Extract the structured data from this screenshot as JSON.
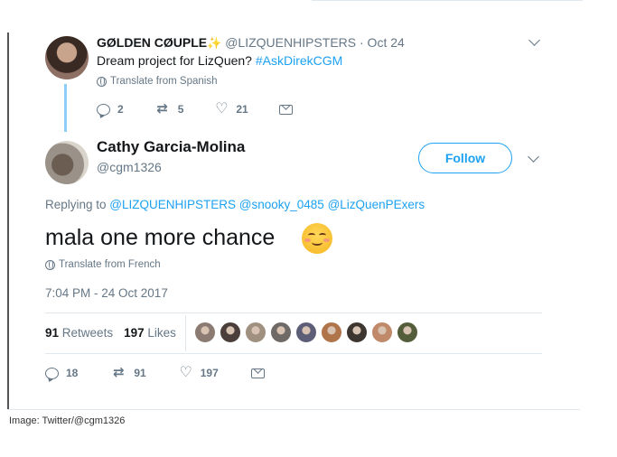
{
  "tweet1": {
    "name": "GØLDEN CØUPLE",
    "sparkle": "✨",
    "handle": "@LIZQUENHIPSTERS",
    "date": "· Oct 24",
    "text": "Dream project for LizQuen? ",
    "hashtag": "#AskDirekCGM",
    "translate": "Translate from Spanish",
    "replies": "2",
    "retweets": "5",
    "likes": "21"
  },
  "tweet2": {
    "name": "Cathy Garcia-Molina",
    "handle": "@cgm1326",
    "follow_label": "Follow",
    "replying_prefix": "Replying to ",
    "mentions": [
      "@LIZQUENHIPSTERS",
      "@snooky_0485",
      "@LizQuenPExers"
    ],
    "text": "mala one more chance",
    "translate": "Translate from French",
    "timestamp": "7:04 PM - 24 Oct 2017",
    "stats": {
      "retweet_count": "91",
      "retweet_label": "Retweets",
      "like_count": "197",
      "like_label": "Likes"
    },
    "liker_colors": [
      "#8b7b72",
      "#4a3f3a",
      "#a09080",
      "#6f6a66",
      "#5c5e77",
      "#b0744a",
      "#3d3530",
      "#c08a6a",
      "#545d3a"
    ],
    "actions": {
      "replies": "18",
      "retweets": "91",
      "likes": "197"
    }
  },
  "caption": "Image: Twitter/@cgm1326",
  "colors": {
    "link": "#1da1f2",
    "muted": "#657786",
    "text": "#14171a",
    "thread_line": "#8ecdf8"
  }
}
